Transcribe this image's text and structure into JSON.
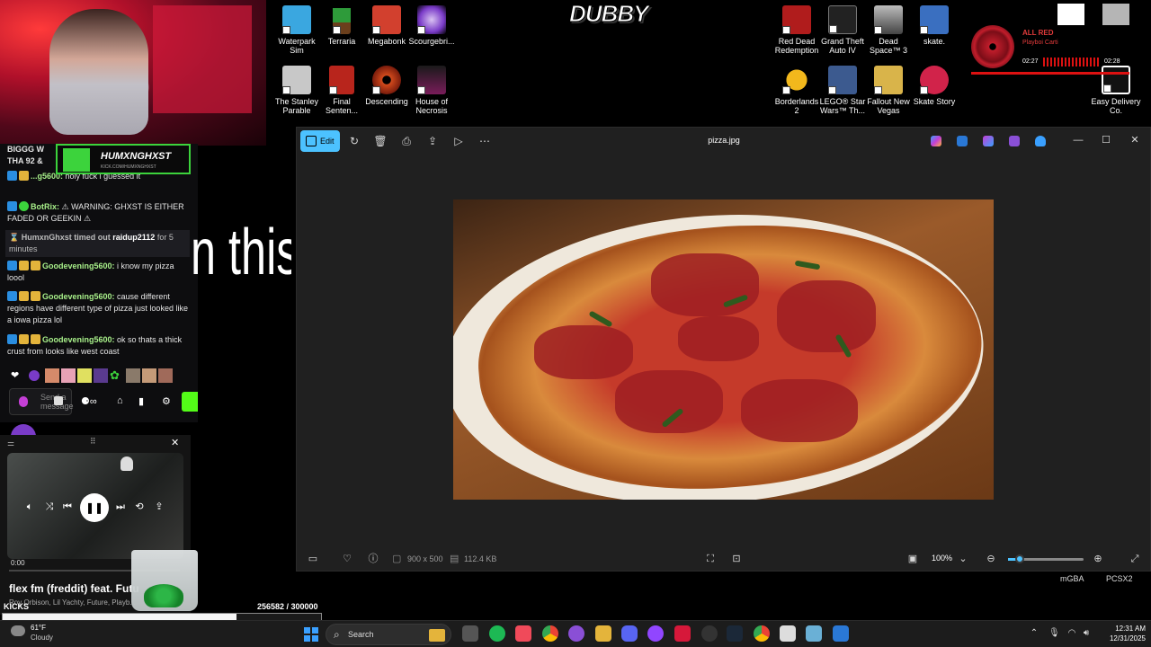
{
  "desktop_icons_left": [
    {
      "label": "Waterpark Sim",
      "icon": "waterpark-icon",
      "color": "#3aa7e0"
    },
    {
      "label": "Terraria",
      "icon": "terraria-tree-icon",
      "color": "#2e9b3a"
    },
    {
      "label": "Megabonk",
      "icon": "megabonk-logo-icon",
      "color": "#d2402e"
    },
    {
      "label": "Scourgebri...",
      "icon": "scourgebringer-icon",
      "color": "#7a3bc8"
    },
    {
      "label": "The Stanley Parable",
      "icon": "stanley-parable-icon",
      "color": "#c8c8c8"
    },
    {
      "label": "Final Senten...",
      "icon": "final-sentence-icon",
      "color": "#b8251c"
    },
    {
      "label": "Descending",
      "icon": "descending-sun-icon",
      "color": "#d24a1c"
    },
    {
      "label": "House of Necrosis",
      "icon": "house-of-necrosis-icon",
      "color": "#7a1c5a"
    }
  ],
  "desktop_icons_right": [
    {
      "label": "Red Dead Redemption",
      "icon": "red-dead-icon",
      "color": "#b01c1c"
    },
    {
      "label": "Grand Theft Auto IV",
      "icon": "gta-iv-icon",
      "color": "#222222"
    },
    {
      "label": "Dead Space™ 3",
      "icon": "dead-space-icon",
      "color": "#8f8f8f"
    },
    {
      "label": "skate.",
      "icon": "skate-icon",
      "color": "#3a6fc0"
    },
    {
      "label": "Borderlands 2",
      "icon": "borderlands-icon",
      "color": "#f2b81c"
    },
    {
      "label": "LEGO® Star Wars™ Th...",
      "icon": "lego-star-wars-icon",
      "color": "#3c5a8f"
    },
    {
      "label": "Fallout New Vegas",
      "icon": "fallout-vault-boy-icon",
      "color": "#d9b44a"
    },
    {
      "label": "Skate Story",
      "icon": "skate-story-icon",
      "color": "#d1234a"
    },
    {
      "label": "Easy Delivery Co.",
      "icon": "easy-delivery-icon",
      "color": "#ffffff"
    }
  ],
  "dubby_logo": "DUBBY",
  "now_playing": {
    "title": "ALL RED",
    "artist": "Playboi Carti",
    "time_current": "02:27",
    "time_total": "02:28"
  },
  "kick_banner": {
    "title": "HUMXNGHXST",
    "subtitle": "KICK.COM/HUMXNGHXST"
  },
  "chat": {
    "messages": [
      {
        "top_text": "BIGGG W",
        "cont": "THA 92 &"
      },
      {
        "user": "Goodevening5600",
        "user_display": "...g5600:",
        "text": "holy fuck i guessed it"
      },
      {
        "user": "BotRix:",
        "text": "⚠ WARNING: GHXST IS EITHER FADED OR GEEKIN ⚠"
      },
      {
        "system": "HumxnGhxst timed out",
        "target": "raidup2112",
        "tail": "for 5 minutes"
      },
      {
        "user": "Goodevening5600:",
        "text": "i know my pizza loool"
      },
      {
        "user": "Goodevening5600:",
        "text": "cause different regions have different type of pizza just looked like a iowa pizza lol"
      },
      {
        "user": "Goodevening5600:",
        "text": "ok so thats a thick crust from looks like west coast"
      }
    ],
    "input_placeholder": "Send a message"
  },
  "caption_text": "n this b",
  "music_player": {
    "time_current": "0:00",
    "song": "flex fm (freddit) feat. Futu",
    "artists": "Roy Orbison, Lil Yachty, Future, Playb..."
  },
  "kicks": {
    "label": "KICKS",
    "count_text": "256582 / 300000",
    "current": 256582,
    "goal": 300000
  },
  "photos_window": {
    "edit_label": "Edit",
    "filename": "pizza.jpg",
    "dimensions": "900 x 500",
    "filesize": "112.4 KB",
    "zoom": "100%",
    "zoom_fraction": 0.15
  },
  "side_labels": {
    "mgba": "mGBA",
    "pcsx2": "PCSX2"
  },
  "taskbar": {
    "temp": "61°F",
    "condition": "Cloudy",
    "search_label": "Search",
    "time": "12:31 AM",
    "date": "12/31/2025"
  }
}
